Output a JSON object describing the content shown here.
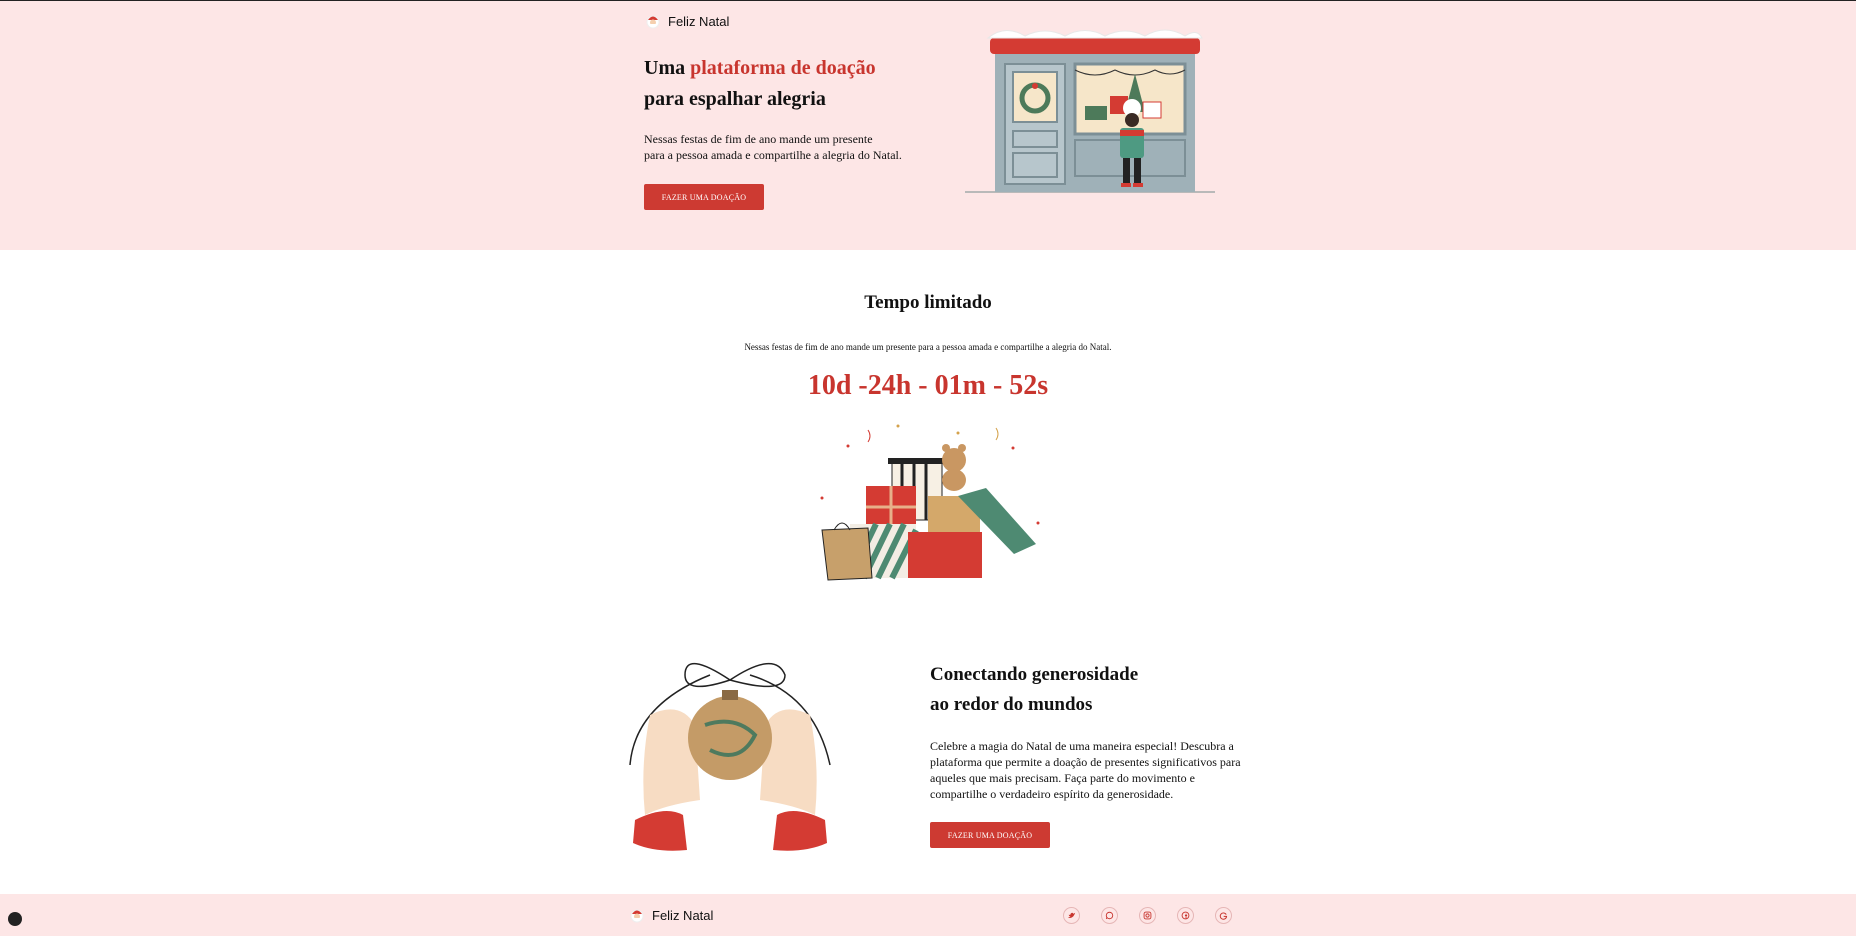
{
  "brand": {
    "name": "Feliz Natal"
  },
  "hero": {
    "title_part1": "Uma ",
    "title_accent": "plataforma de doação",
    "title_line2": "para espalhar alegria",
    "text_line1": "Nessas festas de fim de ano mande um presente",
    "text_line2": "para a pessoa amada e compartilhe a alegria do Natal.",
    "button": "FAZER UMA DOAÇÃO"
  },
  "limited": {
    "title": "Tempo limitado",
    "subtitle": "Nessas festas de fim de ano mande um presente para a pessoa amada e compartilhe a alegria do Natal.",
    "countdown": "10d -24h - 01m - 52s"
  },
  "connect": {
    "title_line1": "Conectando generosidade",
    "title_line2": "ao redor do mundos",
    "text": "Celebre a magia do Natal de uma maneira especial! Descubra a plataforma que permite a doação de presentes significativos para aqueles que mais precisam. Faça parte do movimento e compartilhe o verdadeiro espírito da generosidade.",
    "button": "FAZER UMA DOAÇÃO"
  },
  "footer": {
    "brand": "Feliz Natal",
    "social": [
      "twitter-icon",
      "whatsapp-icon",
      "instagram-icon",
      "facebook-icon",
      "google-icon"
    ]
  },
  "colors": {
    "accent": "#c8352e",
    "hero_bg": "#fde6e6",
    "button": "#cd3a32"
  }
}
